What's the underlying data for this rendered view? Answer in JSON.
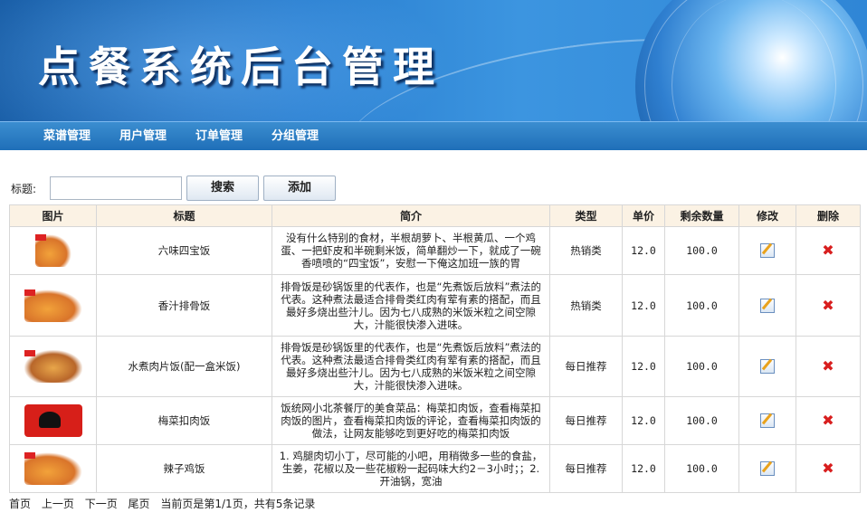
{
  "header": {
    "title": "点餐系统后台管理"
  },
  "nav": {
    "items": [
      {
        "label": "菜谱管理"
      },
      {
        "label": "用户管理"
      },
      {
        "label": "订单管理"
      },
      {
        "label": "分组管理"
      }
    ]
  },
  "search": {
    "label": "标题:",
    "value": "",
    "placeholder": "",
    "search_label": "搜索",
    "add_label": "添加"
  },
  "table": {
    "headers": [
      "图片",
      "标题",
      "简介",
      "类型",
      "单价",
      "剩余数量",
      "修改",
      "删除"
    ],
    "rows": [
      {
        "image_icon": "dish-image-icon",
        "title": "六味四宝饭",
        "desc": "没有什么特别的食材，半根胡萝卜、半根黄瓜、一个鸡蛋、一把虾皮和半碗剩米饭，简单翻炒一下，就成了一碗香喷喷的“四宝饭”，安慰一下俺这加班一族的胃",
        "type": "热销类",
        "price": "12.0",
        "stock": "100.0"
      },
      {
        "image_icon": "dish-image-icon",
        "title": "香汁排骨饭",
        "desc": "排骨饭是砂锅饭里的代表作，也是“先煮饭后放料”煮法的代表。这种煮法最适合排骨类红肉有荤有素的搭配，而且最好多烧出些汁儿。因为七八成熟的米饭米粒之间空隙大，汁能很快渗入进味。",
        "type": "热销类",
        "price": "12.0",
        "stock": "100.0"
      },
      {
        "image_icon": "dish-image-icon",
        "title": "水煮肉片饭(配一盒米饭)",
        "desc": "排骨饭是砂锅饭里的代表作，也是“先煮饭后放料”煮法的代表。这种煮法最适合排骨类红肉有荤有素的搭配，而且最好多烧出些汁儿。因为七八成熟的米饭米粒之间空隙大，汁能很快渗入进味。",
        "type": "每日推荐",
        "price": "12.0",
        "stock": "100.0"
      },
      {
        "image_icon": "dish-image-icon",
        "title": "梅菜扣肉饭",
        "desc": "饭统网小北茶餐厅的美食菜品：梅菜扣肉饭，查看梅菜扣肉饭的图片，查看梅菜扣肉饭的评论，查看梅菜扣肉饭的做法，让网友能够吃到更好吃的梅菜扣肉饭",
        "type": "每日推荐",
        "price": "12.0",
        "stock": "100.0"
      },
      {
        "image_icon": "dish-image-icon",
        "title": "辣子鸡饭",
        "desc": "1. 鸡腿肉切小丁，尽可能的小吧，用稍微多一些的食盐，生姜，花椒以及一些花椒粉一起码味大约2－3小时；；2.开油锅，宽油",
        "type": "每日推荐",
        "price": "12.0",
        "stock": "100.0"
      }
    ]
  },
  "pager": {
    "first": "首页",
    "prev": "上一页",
    "next": "下一页",
    "last": "尾页",
    "status": "当前页是第1/1页，共有5条记录"
  },
  "icons": {
    "edit": "edit-icon",
    "delete": "delete-icon"
  },
  "colors": {
    "banner": "#2a7fd0",
    "nav": "#1f6fb8",
    "table_header": "#fbf2e4",
    "delete": "#d81e1e"
  }
}
